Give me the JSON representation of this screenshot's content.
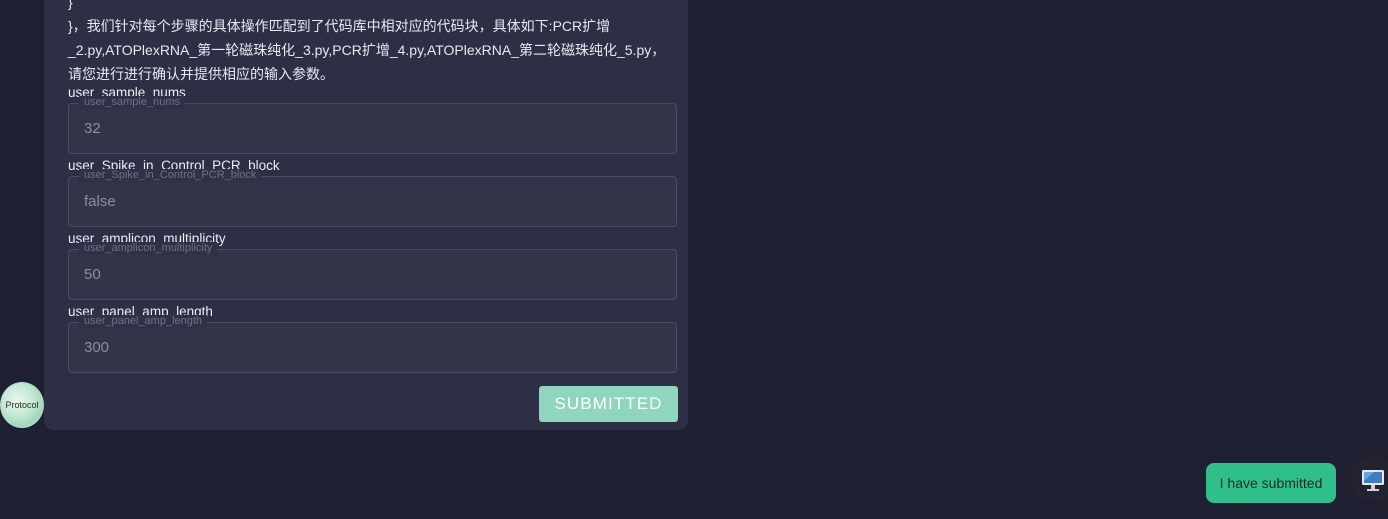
{
  "bot_message": {
    "closing_brace": "}",
    "text": "}，我们针对每个步骤的具体操作匹配到了代码库中相对应的代码块，具体如下:PCR扩增_2.py,ATOPlexRNA_第一轮磁珠纯化_3.py,PCR扩增_4.py,ATOPlexRNA_第二轮磁珠纯化_5.py，请您进行进行确认并提供相应的输入参数。",
    "avatar_label": "Protocol"
  },
  "form": {
    "fields": [
      {
        "label": "user_sample_nums",
        "legend": "user_sample_nums",
        "value": "32"
      },
      {
        "label": "user_Spike_in_Control_PCR_block",
        "legend": "user_Spike_in_Control_PCR_block",
        "value": "false"
      },
      {
        "label": "user_amplicon_multiplicity",
        "legend": "user_amplicon_multiplicity",
        "value": "50"
      },
      {
        "label": "user_panel_amp_length",
        "legend": "user_panel_amp_length",
        "value": "300"
      }
    ],
    "submit_label": "SUBMITTED"
  },
  "user_message": {
    "text": "I have submitted"
  },
  "colors": {
    "page_background": "#1e1f30",
    "bubble_background": "#2d2f45",
    "submit_button": "#8ed6bd",
    "user_bubble": "#2fbf8b"
  }
}
